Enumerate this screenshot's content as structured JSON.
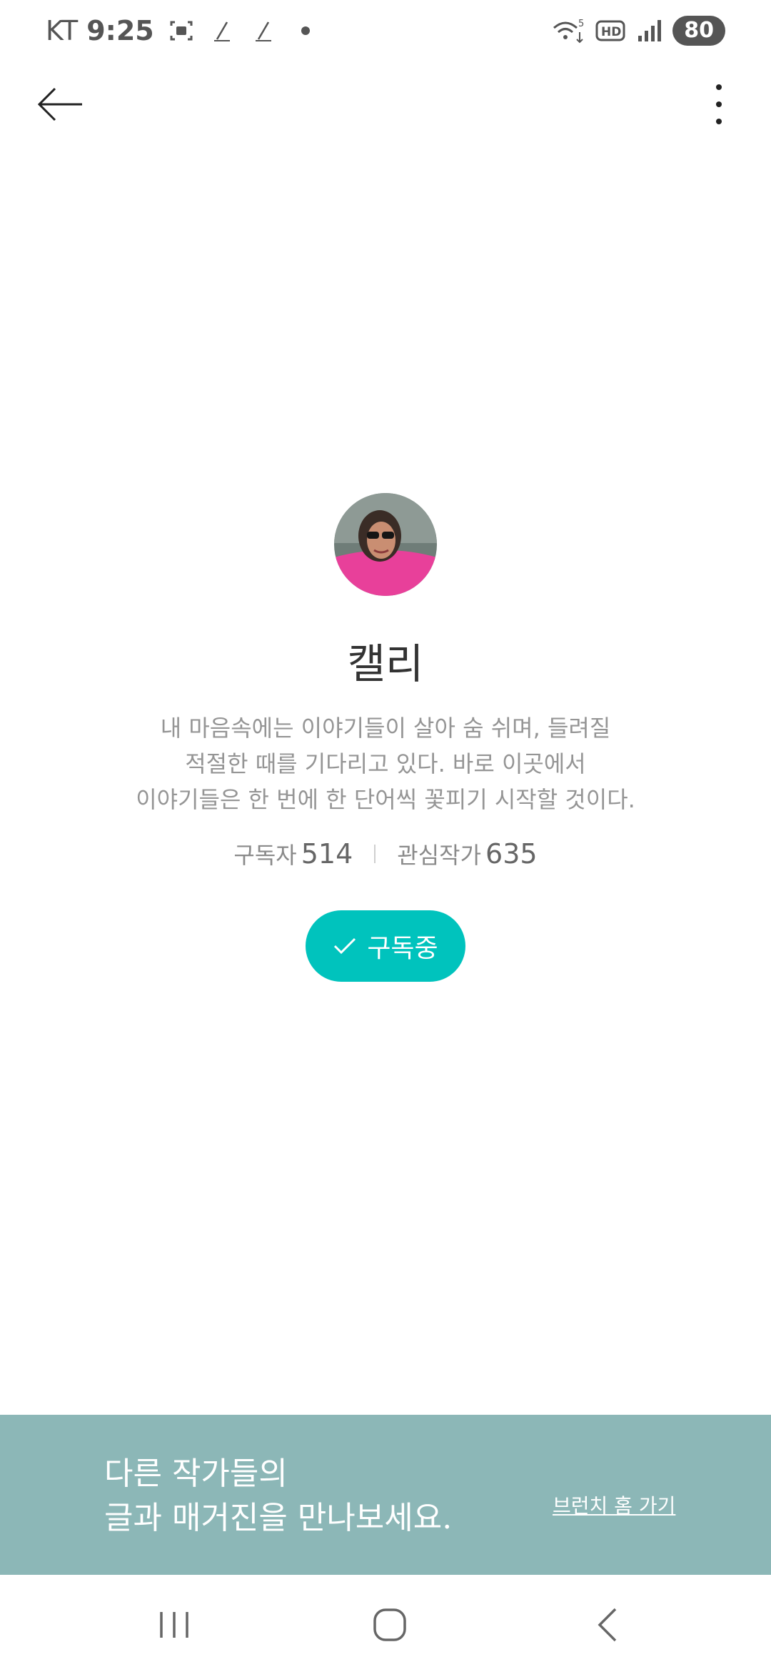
{
  "status_bar": {
    "carrier": "KT",
    "time": "9:25",
    "network": "5",
    "hd_label": "HD",
    "battery": "80"
  },
  "profile": {
    "name": "캘리",
    "bio_lines": [
      "내 마음속에는 이야기들이 살아 숨 쉬며, 들려질",
      "적절한 때를 기다리고 있다. 바로 이곳에서",
      "이야기들은 한 번에 한 단어씩 꽃피기 시작할 것이다."
    ],
    "subscribers_label": "구독자",
    "subscribers_count": "514",
    "following_label": "관심작가",
    "following_count": "635",
    "subscribe_button_label": "구독중"
  },
  "banner": {
    "line1": "다른 작가들의",
    "line2": "글과 매거진을 만나보세요.",
    "link_label": "브런치 홈 가기"
  },
  "colors": {
    "accent": "#00c3bd",
    "banner_bg": "#8cb7b7"
  }
}
